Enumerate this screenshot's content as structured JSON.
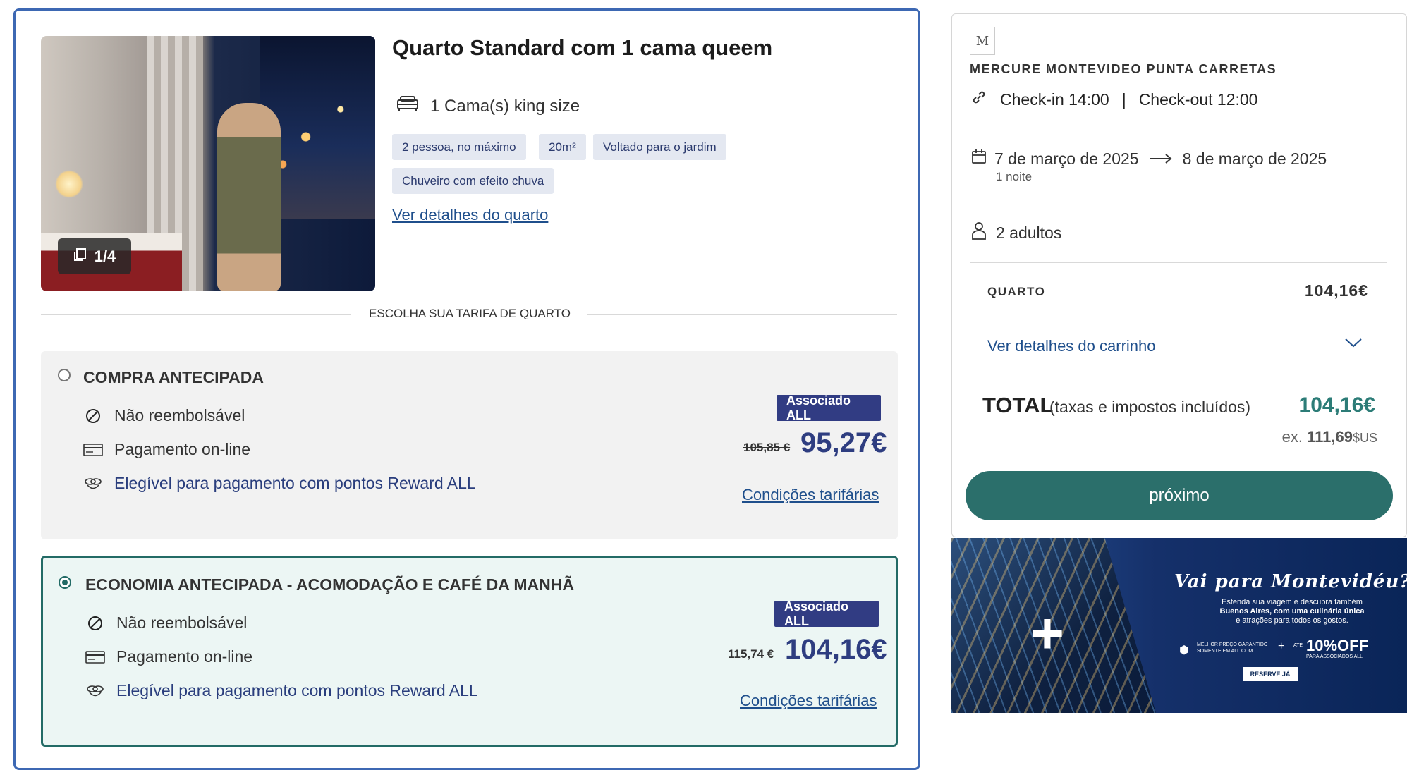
{
  "room": {
    "title": "Quarto Standard com 1 cama queem",
    "photo_counter": "1/4",
    "bed": "1 Cama(s) king size",
    "chips": [
      "2 pessoa, no máximo",
      "20m²",
      "Voltado para o jardim",
      "Chuveiro com efeito chuva"
    ],
    "details_link": "Ver detalhes do quarto"
  },
  "rate_section_heading": "ESCOLHA SUA TARIFA DE QUARTO",
  "rates": [
    {
      "name": "COMPRA ANTECIPADA",
      "selected": false,
      "features": [
        "Não reembolsável",
        "Pagamento on-line",
        "Elegível para pagamento com pontos Reward ALL"
      ],
      "badge": "Associado ALL",
      "old_price": "105,85 €",
      "price": "95,27€",
      "conditions_link": "Condições tarifárias"
    },
    {
      "name": "ECONOMIA ANTECIPADA - ACOMODAÇÃO E CAFÉ DA MANHÃ",
      "selected": true,
      "features": [
        "Não reembolsável",
        "Pagamento on-line",
        "Elegível para pagamento com pontos Reward ALL"
      ],
      "badge": "Associado ALL",
      "old_price": "115,74 €",
      "price": "104,16€",
      "conditions_link": "Condições tarifárias"
    }
  ],
  "summary": {
    "hotel_name": "MERCURE MONTEVIDEO PUNTA CARRETAS",
    "checkin": "Check-in 14:00",
    "separator": "|",
    "checkout": "Check-out 12:00",
    "date_from": "7 de março de 2025",
    "date_to": "8 de março de 2025",
    "nights": "1 noite",
    "guests": "2 adultos",
    "room_label": "QUARTO",
    "room_price": "104,16€",
    "cart_link": "Ver detalhes do carrinho",
    "total_label": "TOTAL",
    "total_note": "(taxas e impostos incluídos)",
    "total_price": "104,16€",
    "total_ex_prefix": "ex.",
    "total_ex_value": "111,69",
    "total_ex_currency": "$US",
    "next_button": "próximo"
  },
  "promo": {
    "title": "Vai para Montevidéu?",
    "line1": "Estenda sua viagem e descubra também",
    "line2": "Buenos Aires, com uma culinária única",
    "line3": "e atrações para todos os gostos.",
    "guarantee": "MELHOR PREÇO GARANTIDO SOMENTE EM ALL.COM",
    "offer_prefix": "ATÉ",
    "offer": "10%OFF",
    "offer_note": "PARA ASSOCIADOS ALL",
    "reserve": "RESERVE JÁ"
  },
  "colors": {
    "accent_teal": "#2b6f6b",
    "badge_navy": "#313c83",
    "card_border": "#3d68b3",
    "link_blue": "#1f4f8c"
  }
}
